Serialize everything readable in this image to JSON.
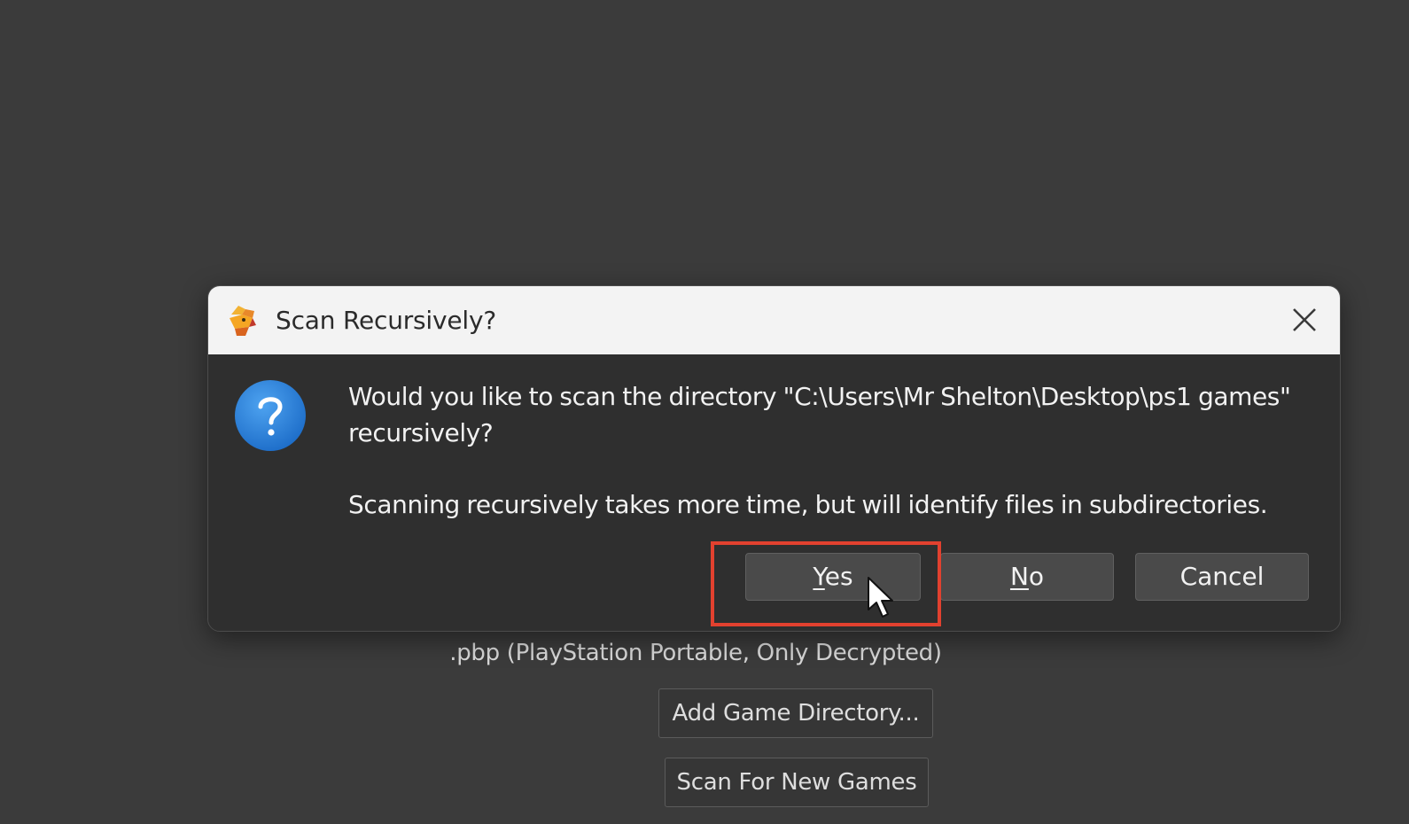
{
  "background": {
    "formats_line": ".pbp (PlayStation Portable, Only Decrypted)",
    "add_directory_label": "Add Game Directory...",
    "scan_label": "Scan For New Games"
  },
  "dialog": {
    "title": "Scan Recursively?",
    "app_icon": "duckstation-icon",
    "question_icon": "question-icon",
    "message": "Would you like to scan the directory \"C:\\Users\\Mr Shelton\\Desktop\\ps1 games\" recursively?",
    "info": "Scanning recursively takes more time, but will identify files in subdirectories.",
    "buttons": {
      "yes_mnemonic": "Y",
      "yes_rest": "es",
      "no_mnemonic": "N",
      "no_rest": "o",
      "cancel": "Cancel"
    }
  },
  "colors": {
    "highlight": "#e2412f",
    "question_icon": "#2a7fd6",
    "background": "#3b3b3b"
  }
}
